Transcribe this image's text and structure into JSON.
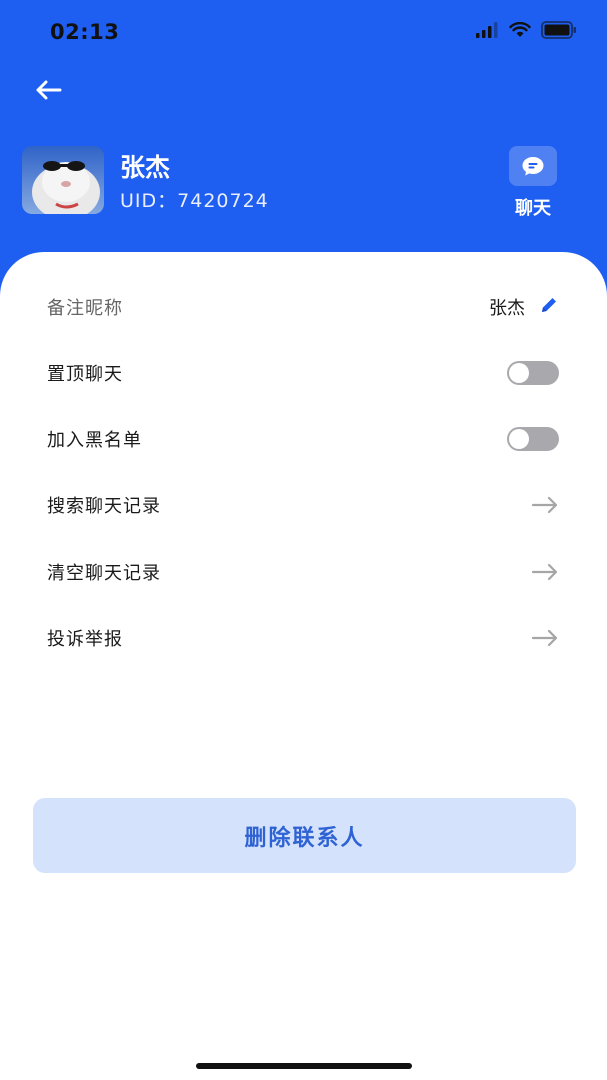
{
  "status_bar": {
    "time": "02:13",
    "icons": [
      "signal-icon",
      "wifi-icon",
      "battery-icon"
    ]
  },
  "header": {
    "back_icon": "arrow-left-icon",
    "name": "张杰",
    "uid": "UID：7420724",
    "chat_icon": "chat-bubble-icon",
    "chat_label": "聊天"
  },
  "settings": {
    "remark_label": "备注昵称",
    "remark_value": "张杰",
    "remark_icon": "pencil-icon",
    "pin_label": "置顶聊天",
    "pin_enabled": false,
    "blacklist_label": "加入黑名单",
    "blacklist_enabled": false,
    "search_label": "搜索聊天记录",
    "clear_label": "清空聊天记录",
    "report_label": "投诉举报",
    "arrow_icon": "arrow-right-icon"
  },
  "delete_button": "删除联系人",
  "colors": {
    "header_bg": "#1e5ef0",
    "delete_bg": "#d4e2fb",
    "delete_text": "#2f63d4",
    "toggle_off": "#a9a9ad"
  }
}
